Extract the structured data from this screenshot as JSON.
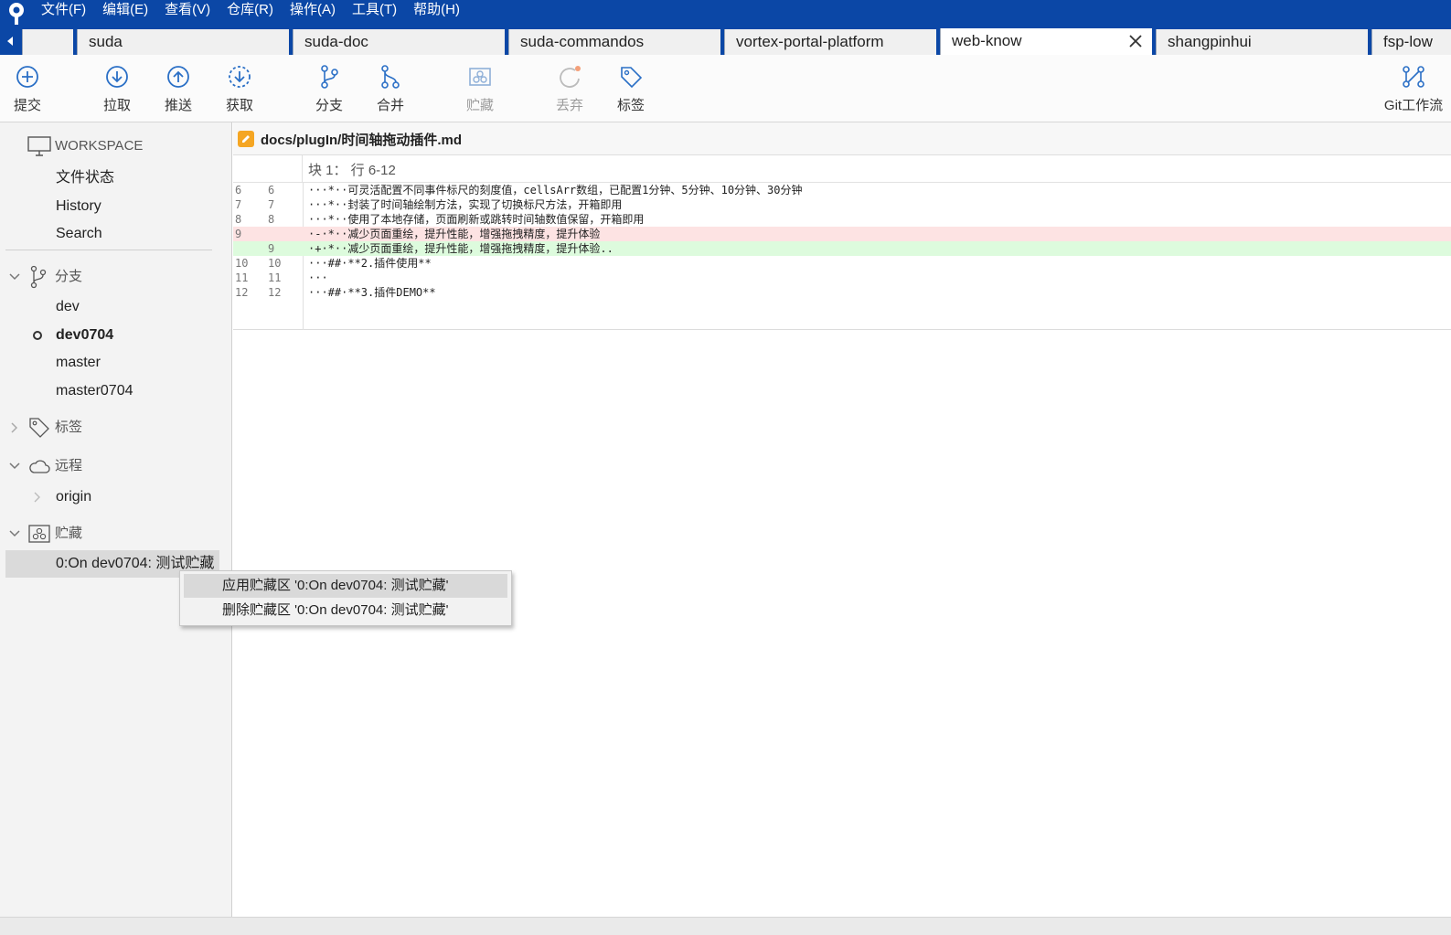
{
  "menubar": {
    "items": [
      "文件(F)",
      "编辑(E)",
      "查看(V)",
      "仓库(R)",
      "操作(A)",
      "工具(T)",
      "帮助(H)"
    ]
  },
  "tabs": [
    "",
    "suda",
    "suda-doc",
    "suda-commandos",
    "vortex-portal-platform",
    "web-know",
    "shangpinhui",
    "fsp-low"
  ],
  "active_tab": "web-know",
  "toolbar": {
    "commit": "提交",
    "pull": "拉取",
    "push": "推送",
    "fetch": "获取",
    "branch": "分支",
    "merge": "合并",
    "stash": "贮藏",
    "discard": "丢弃",
    "tag": "标签",
    "gitflow": "Git工作流"
  },
  "sidebar": {
    "workspace": "WORKSPACE",
    "workspace_items": [
      "文件状态",
      "History",
      "Search"
    ],
    "branches_header": "分支",
    "branches": [
      "dev",
      "dev0704",
      "master",
      "master0704"
    ],
    "current_branch": "dev0704",
    "tags_header": "标签",
    "remotes_header": "远程",
    "remotes": [
      "origin"
    ],
    "stashes_header": "贮藏",
    "stashes": [
      "0:On dev0704: 测试贮藏"
    ]
  },
  "file": {
    "path": "docs/plugIn/时间轴拖动插件.md"
  },
  "hunk": {
    "header": "块 1： 行 6-12",
    "lines": [
      {
        "old": "6",
        "new": "6",
        "type": "context",
        "marker": "",
        "text": "···*··可灵活配置不同事件标尺的刻度值，cellsArr数组，已配置1分钟、5分钟、10分钟、30分钟"
      },
      {
        "old": "7",
        "new": "7",
        "type": "context",
        "marker": "",
        "text": "···*··封装了时间轴绘制方法，实现了切换标尺方法，开箱即用"
      },
      {
        "old": "8",
        "new": "8",
        "type": "context",
        "marker": "",
        "text": "···*··使用了本地存储，页面刷新或跳转时间轴数值保留，开箱即用"
      },
      {
        "old": "9",
        "new": "",
        "type": "removed",
        "marker": "-",
        "text": "·-·*··减少页面重绘，提升性能，增强拖拽精度，提升体验"
      },
      {
        "old": "",
        "new": "9",
        "type": "added",
        "marker": "+",
        "text": "·+·*··减少页面重绘，提升性能，增强拖拽精度，提升体验.."
      },
      {
        "old": "10",
        "new": "10",
        "type": "context",
        "marker": "",
        "text": "···##·**2.插件使用**"
      },
      {
        "old": "11",
        "new": "11",
        "type": "context",
        "marker": "",
        "text": "···"
      },
      {
        "old": "12",
        "new": "12",
        "type": "context",
        "marker": "",
        "text": "···##·**3.插件DEMO**"
      }
    ]
  },
  "context_menu": {
    "apply": "应用贮藏区 '0:On dev0704: 测试贮藏'",
    "delete": "删除贮藏区 '0:On dev0704: 测试贮藏'"
  },
  "colors": {
    "accent": "#0b47a6",
    "icon": "#2a6fc6",
    "removed_bg": "#fde3e3",
    "added_bg": "#ddfbdd"
  }
}
